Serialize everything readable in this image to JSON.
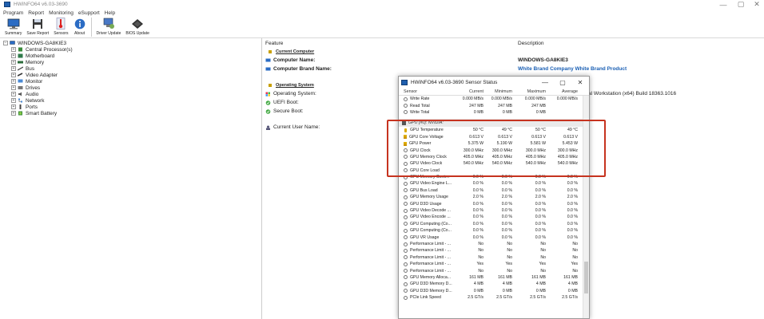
{
  "window": {
    "title": "HWiNFO64 v6.03-3690",
    "minimize": "—",
    "maximize": "▢",
    "close": "✕"
  },
  "menu": [
    "Program",
    "Report",
    "Monitoring",
    "eSupport",
    "Help"
  ],
  "toolbar": [
    {
      "label": "Summary",
      "icon": "monitor-icon"
    },
    {
      "label": "Save Report",
      "icon": "floppy-icon"
    },
    {
      "label": "Sensors",
      "icon": "thermometer-icon"
    },
    {
      "label": "About",
      "icon": "info-icon"
    },
    {
      "label": "Driver Update",
      "icon": "driver-update-icon"
    },
    {
      "label": "BIOS Update",
      "icon": "bios-chip-icon"
    }
  ],
  "tree": {
    "root": "WINDOWS-GA8KIE3",
    "items": [
      "Central Processor(s)",
      "Motherboard",
      "Memory",
      "Bus",
      "Video Adapter",
      "Monitor",
      "Drives",
      "Audio",
      "Network",
      "Ports",
      "Smart Battery"
    ]
  },
  "details": {
    "feature_header": "Feature",
    "description_header": "Description",
    "current_computer_section": "Current Computer",
    "computer_name_label": "Computer Name:",
    "computer_name_value": "WINDOWS-GA8KIE3",
    "computer_brand_label": "Computer Brand Name:",
    "computer_brand_value": "White Brand Company White Brand Product",
    "operating_system_section": "Operating System",
    "os_label": "Operating System:",
    "os_value_tail": "al Workstation (x64) Build 18363.1016",
    "uefi_label": "UEFI Boot:",
    "secure_boot_label": "Secure Boot:",
    "current_user_label": "Current User Name:"
  },
  "sensor_dialog": {
    "title": "HWiNFO64 v6.03-3690 Sensor Status",
    "columns": [
      "Sensor",
      "Current",
      "Minimum",
      "Maximum",
      "Average"
    ],
    "top_rows": [
      [
        "Write Rate",
        "0.000 MB/s",
        "0.000 MB/s",
        "0.000 MB/s",
        "0.000 MB/s"
      ],
      [
        "Read Total",
        "247 MB",
        "247 MB",
        "247 MB",
        ""
      ],
      [
        "Write Total",
        "0 MB",
        "0 MB",
        "0 MB",
        ""
      ]
    ],
    "gpu_group": "GPU [#0]: NVIDIA:",
    "highlighted_rows": [
      [
        "GPU Temperature",
        "50 °C",
        "49 °C",
        "50 °C",
        "49 °C"
      ],
      [
        "GPU Core Voltage",
        "0.613 V",
        "0.613 V",
        "0.613 V",
        "0.613 V"
      ],
      [
        "GPU Power",
        "5.375 W",
        "5.190 W",
        "5.581 W",
        "5.453 W"
      ],
      [
        "GPU Clock",
        "300.0 MHz",
        "300.0 MHz",
        "300.0 MHz",
        "300.0 MHz"
      ],
      [
        "GPU Memory Clock",
        "405.0 MHz",
        "405.0 MHz",
        "405.0 MHz",
        "405.0 MHz"
      ],
      [
        "GPU Video Clock",
        "540.0 MHz",
        "540.0 MHz",
        "540.0 MHz",
        "540.0 MHz"
      ]
    ],
    "lower_rows": [
      [
        "GPU Core Load",
        "",
        "",
        "",
        ""
      ],
      [
        "GPU Memory Contr...",
        "0.0 %",
        "0.0 %",
        "0.0 %",
        "0.0 %"
      ],
      [
        "GPU Video Engine L...",
        "0.0 %",
        "0.0 %",
        "0.0 %",
        "0.0 %"
      ],
      [
        "GPU Bus Load",
        "0.0 %",
        "0.0 %",
        "0.0 %",
        "0.0 %"
      ],
      [
        "GPU Memory Usage",
        "2.0 %",
        "2.0 %",
        "2.0 %",
        "2.0 %"
      ],
      [
        "GPU D3D Usage",
        "0.0 %",
        "0.0 %",
        "0.0 %",
        "0.0 %"
      ],
      [
        "GPU Video Decode ...",
        "0.0 %",
        "0.0 %",
        "0.0 %",
        "0.0 %"
      ],
      [
        "GPU Video Encode ...",
        "0.0 %",
        "0.0 %",
        "0.0 %",
        "0.0 %"
      ],
      [
        "GPU Computing (Co...",
        "0.0 %",
        "0.0 %",
        "0.0 %",
        "0.0 %"
      ],
      [
        "GPU Computing (Co...",
        "0.0 %",
        "0.0 %",
        "0.0 %",
        "0.0 %"
      ],
      [
        "GPU VR Usage",
        "0.0 %",
        "0.0 %",
        "0.0 %",
        "0.0 %"
      ],
      [
        "Performance Limit - ...",
        "No",
        "No",
        "No",
        "No"
      ],
      [
        "Performance Limit - ...",
        "No",
        "No",
        "No",
        "No"
      ],
      [
        "Performance Limit - ...",
        "No",
        "No",
        "No",
        "No"
      ],
      [
        "Performance Limit - ...",
        "Yes",
        "Yes",
        "Yes",
        "Yes"
      ],
      [
        "Performance Limit - ...",
        "No",
        "No",
        "No",
        "No"
      ],
      [
        "GPU Memory Alloca...",
        "161 MB",
        "161 MB",
        "161 MB",
        "161 MB"
      ],
      [
        "GPU D3D Memory D...",
        "4 MB",
        "4 MB",
        "4 MB",
        "4 MB"
      ],
      [
        "GPU D3D Memory D...",
        "0 MB",
        "0 MB",
        "0 MB",
        "0 MB"
      ],
      [
        "PCIe Link Speed",
        "2.5 GT/s",
        "2.5 GT/s",
        "2.5 GT/s",
        "2.5 GT/s"
      ]
    ]
  },
  "colors": {
    "highlight": "#c6331f",
    "link_blue": "#1a5fb4"
  }
}
